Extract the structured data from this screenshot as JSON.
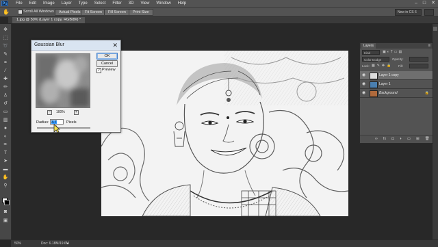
{
  "menubar": {
    "app_logo": "Ps",
    "items": [
      "File",
      "Edit",
      "Image",
      "Layer",
      "Type",
      "Select",
      "Filter",
      "3D",
      "View",
      "Window",
      "Help"
    ]
  },
  "options_bar": {
    "scroll_all_windows": "Scroll All Windows",
    "actual_pixels": "Actual Pixels",
    "fit_screen": "Fit Screen",
    "fill_screen": "Fill Screen",
    "print_size": "Print Size",
    "workspace": "New in CS 6"
  },
  "document_tab": {
    "label": "1.jpg @ 50% (Layer 1 copy, RGB/8#) *"
  },
  "status_bar": {
    "zoom": "50%",
    "doc_info": "Doc: 6.18M/19.6M"
  },
  "layers_panel": {
    "tab_label": "Layers",
    "kind_filter": "Kind",
    "blend_mode": "Color Dodge",
    "opacity_label": "Opacity:",
    "lock_label": "Lock:",
    "fill_label": "Fill:",
    "layers": [
      {
        "name": "Layer 1 copy",
        "selected": true,
        "italic": false,
        "thumb": "#dcdcdc"
      },
      {
        "name": "Layer 1",
        "selected": false,
        "italic": false,
        "thumb": "#4a7fb0"
      },
      {
        "name": "Background",
        "selected": false,
        "italic": true,
        "thumb": "#b06a3c"
      }
    ]
  },
  "gaussian_blur": {
    "title": "Gaussian Blur",
    "ok": "OK",
    "cancel": "Cancel",
    "preview_label": "Preview",
    "preview_checked": true,
    "zoom": "100%",
    "radius_label": "Radius:",
    "radius_value": "3.7",
    "radius_unit": "Pixels"
  },
  "colors": {
    "foreground": "#ffffff",
    "background": "#000000",
    "dialog_title_bar": "#d9e4f1"
  }
}
